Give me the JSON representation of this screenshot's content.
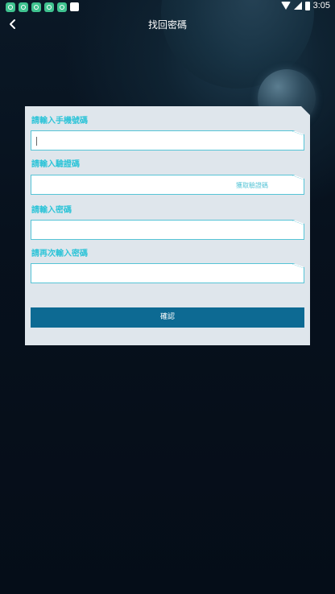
{
  "status_bar": {
    "time": "3:05",
    "notification_icons": [
      "app-notification-icon",
      "app-notification-icon",
      "app-notification-icon",
      "app-notification-icon",
      "app-notification-icon",
      "media-icon"
    ]
  },
  "header": {
    "title": "找回密碼"
  },
  "form": {
    "phone": {
      "label": "請輸入手機號碼",
      "value": "",
      "placeholder": ""
    },
    "verification": {
      "label": "請輸入驗證碼",
      "value": "",
      "placeholder": "",
      "get_code_label": "獲取驗證碼"
    },
    "password": {
      "label": "請輸入密碼",
      "value": "",
      "placeholder": ""
    },
    "confirm_password": {
      "label": "請再次輸入密碼",
      "value": "",
      "placeholder": ""
    },
    "submit_label": "確認"
  },
  "colors": {
    "accent": "#2ec4d8",
    "button": "#0d6a93",
    "card": "#dfe6ec",
    "background": "#06101c"
  }
}
